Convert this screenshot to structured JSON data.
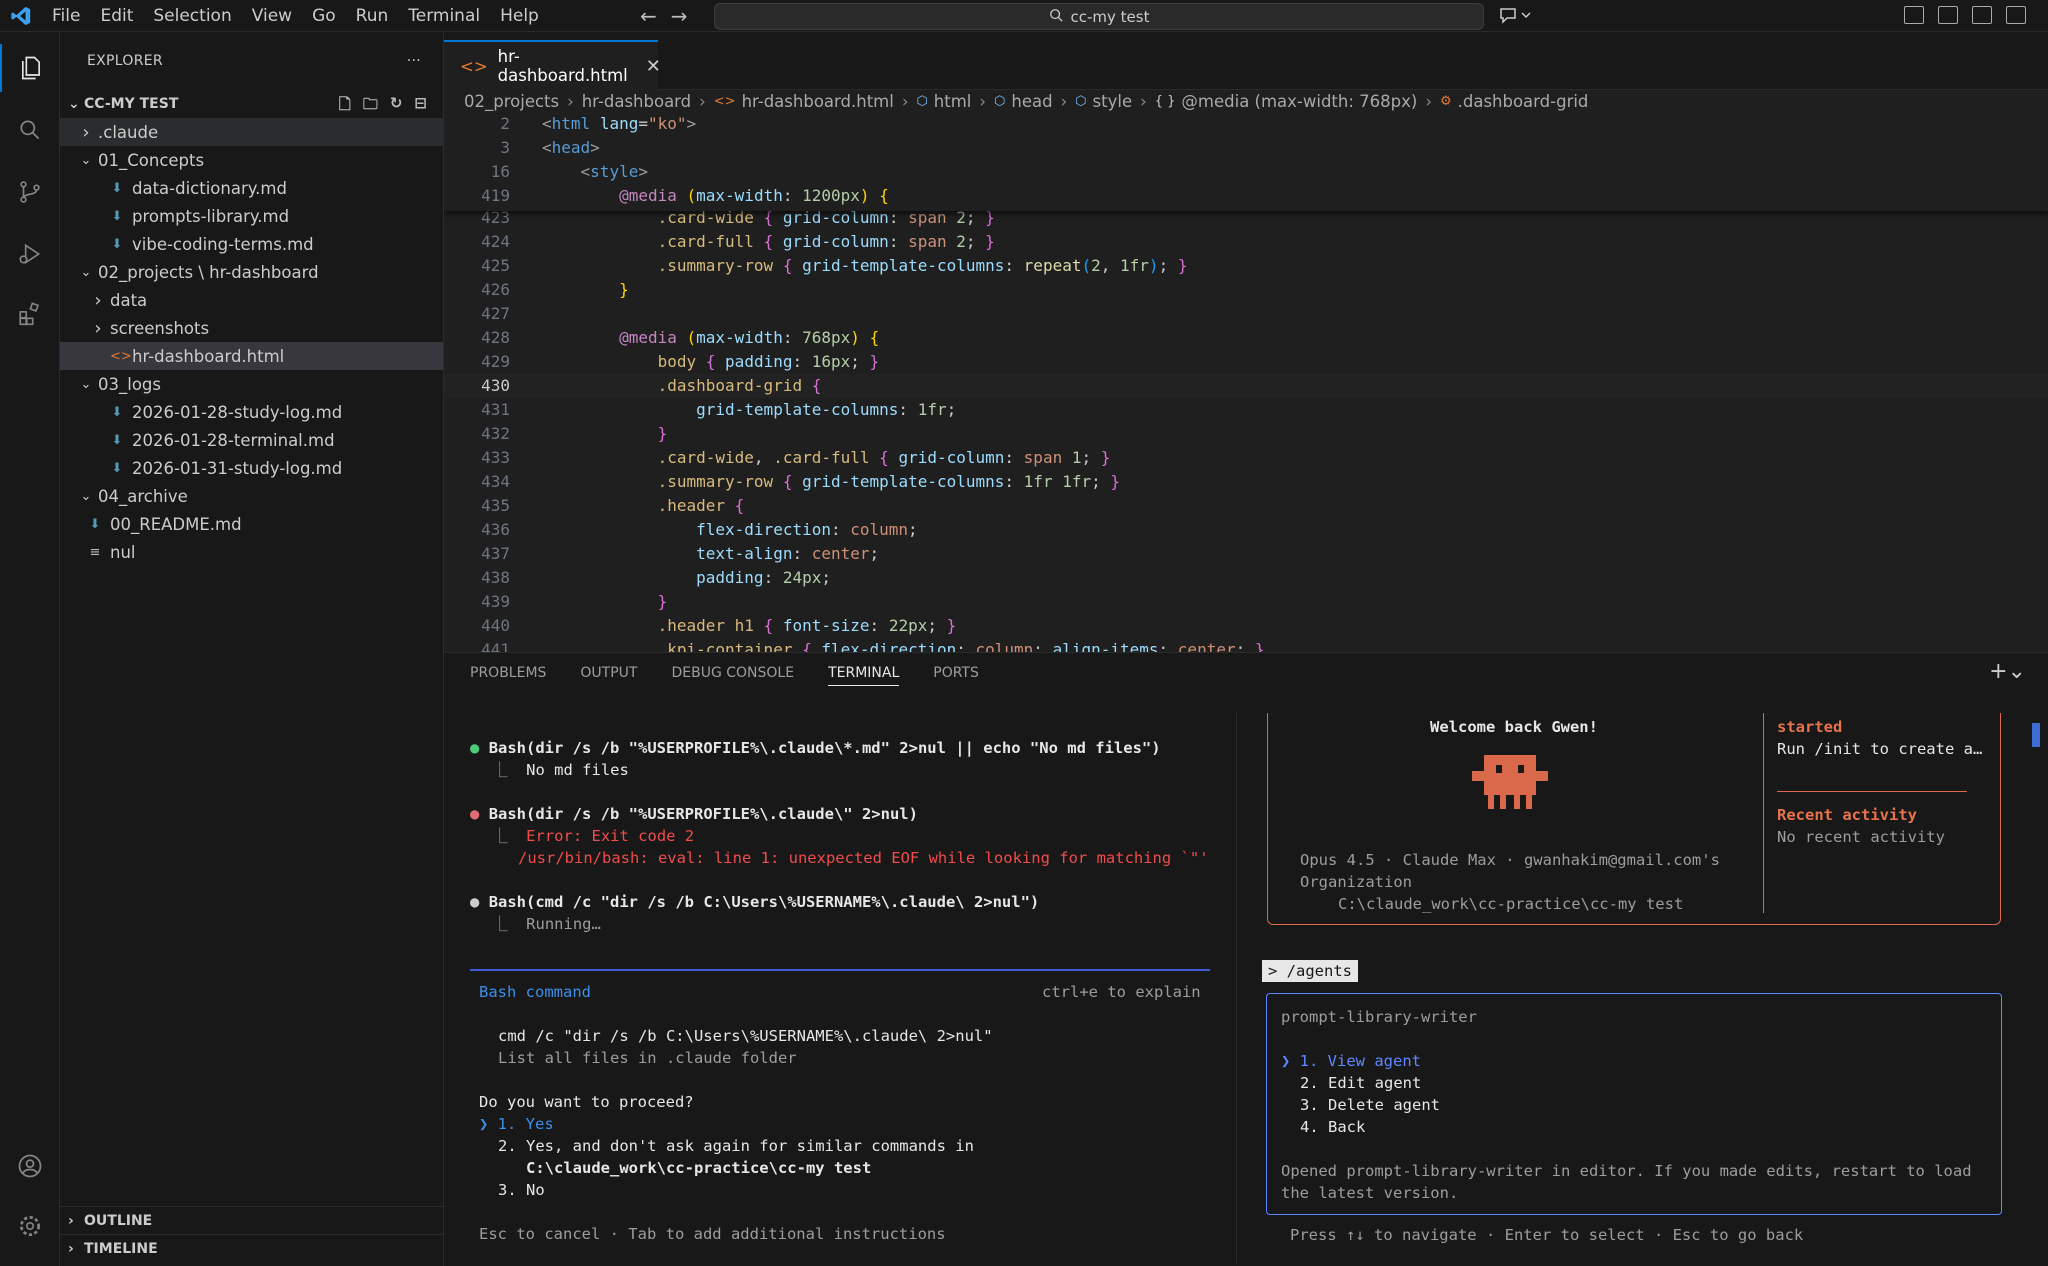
{
  "menu": [
    "File",
    "Edit",
    "Selection",
    "View",
    "Go",
    "Run",
    "Terminal",
    "Help"
  ],
  "search": {
    "label": "cc-my test"
  },
  "explorer": {
    "title": "EXPLORER",
    "more": "···",
    "root": "CC-MY TEST",
    "items": [
      {
        "label": ".claude",
        "type": "folder",
        "open": false,
        "indent": 0
      },
      {
        "label": "01_Concepts",
        "type": "folder",
        "open": true,
        "indent": 0
      },
      {
        "label": "data-dictionary.md",
        "type": "md",
        "indent": 1
      },
      {
        "label": "prompts-library.md",
        "type": "md",
        "indent": 1
      },
      {
        "label": "vibe-coding-terms.md",
        "type": "md",
        "indent": 1
      },
      {
        "label": "02_projects \\ hr-dashboard",
        "type": "folder",
        "open": true,
        "indent": 0
      },
      {
        "label": "data",
        "type": "folder",
        "open": false,
        "indent": 1
      },
      {
        "label": "screenshots",
        "type": "folder",
        "open": false,
        "indent": 1
      },
      {
        "label": "hr-dashboard.html",
        "type": "html",
        "indent": 1,
        "selected": true
      },
      {
        "label": "03_logs",
        "type": "folder",
        "open": true,
        "indent": 0
      },
      {
        "label": "2026-01-28-study-log.md",
        "type": "md",
        "indent": 1
      },
      {
        "label": "2026-01-28-terminal.md",
        "type": "md",
        "indent": 1
      },
      {
        "label": "2026-01-31-study-log.md",
        "type": "md",
        "indent": 1
      },
      {
        "label": "04_archive",
        "type": "folder",
        "open": true,
        "indent": 0
      },
      {
        "label": "00_README.md",
        "type": "md",
        "indent": 0
      },
      {
        "label": "nul",
        "type": "txt",
        "indent": 0
      }
    ],
    "outline": "OUTLINE",
    "timeline": "TIMELINE"
  },
  "editor": {
    "tab": "hr-dashboard.html",
    "breadcrumb": [
      "02_projects",
      "hr-dashboard",
      "hr-dashboard.html",
      "html",
      "head",
      "style",
      "@media (max-width: 768px)",
      ".dashboard-grid"
    ]
  },
  "panel": {
    "tabs": [
      "PROBLEMS",
      "OUTPUT",
      "DEBUG CONSOLE",
      "TERMINAL",
      "PORTS"
    ],
    "active_tab": "TERMINAL"
  },
  "terminal_left": {
    "cmd1": "Bash(dir /s /b \"%USERPROFILE%\\.claude\\*.md\" 2>nul || echo \"No md files\")",
    "out1": "No md files",
    "cmd2": "Bash(dir /s /b \"%USERPROFILE%\\.claude\\\" 2>nul)",
    "err1": "Error: Exit code 2",
    "err2": "/usr/bin/bash: eval: line 1: unexpected EOF while looking for matching `\"'",
    "cmd3": "Bash(cmd /c \"dir /s /b C:\\Users\\%USERNAME%\\.claude\\ 2>nul\")",
    "running": "Running…",
    "bash_title": "Bash command",
    "explain": "ctrl+e to explain",
    "command": "cmd /c \"dir /s /b C:\\Users\\%USERNAME%\\.claude\\ 2>nul\"",
    "command_desc": "List all files in .claude folder",
    "question": "Do you want to proceed?",
    "opt1": "1. Yes",
    "opt2a": "2. Yes, and don't ask again for similar commands in",
    "opt2b": "C:\\claude_work\\cc-practice\\cc-my test",
    "opt3": "3. No",
    "footer": "Esc to cancel · Tab to add additional instructions"
  },
  "terminal_right": {
    "welcome": "Welcome back Gwen!",
    "model_line": "Opus 4.5 · Claude Max · gwanhakim@gmail.com's",
    "org": "Organization",
    "path": "C:\\claude_work\\cc-practice\\cc-my test",
    "started_title": "started",
    "started_text": "Run /init to create a…",
    "recent_title": "Recent activity",
    "recent_text": "No recent activity",
    "prompt": "> /agents",
    "agent_name": "prompt-library-writer",
    "options": [
      "1. View agent",
      "2. Edit agent",
      "3. Delete agent",
      "4. Back"
    ],
    "note1": "Opened prompt-library-writer in editor. If you made edits, restart to load",
    "note2": "the latest version.",
    "footer": "Press ↑↓ to navigate · Enter to select · Esc to go back"
  }
}
